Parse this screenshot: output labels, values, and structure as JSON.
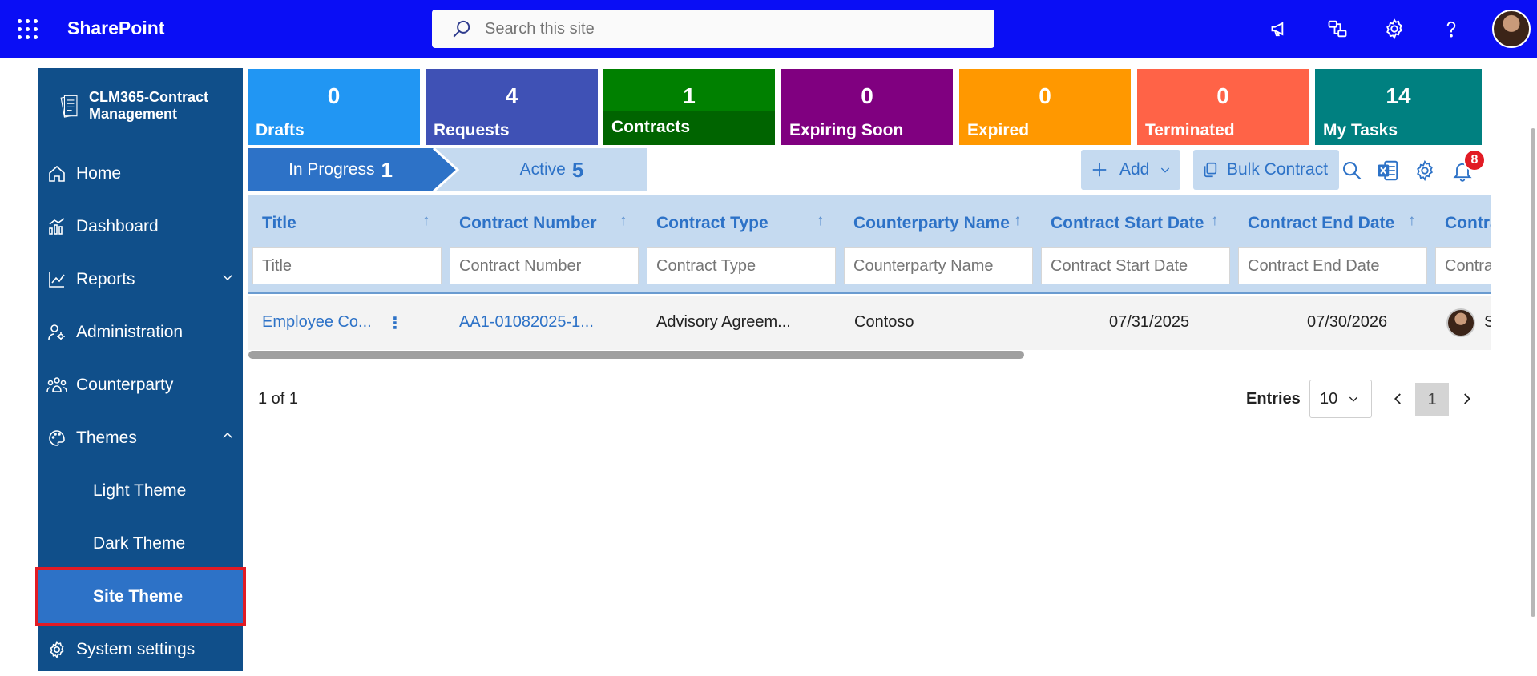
{
  "app": {
    "brand": "SharePoint",
    "search_placeholder": "Search this site",
    "logo_text": "CLM365-Contract Management"
  },
  "sidebar": {
    "items": [
      {
        "label": "Home",
        "icon": "home-icon"
      },
      {
        "label": "Dashboard",
        "icon": "dashboard-icon"
      },
      {
        "label": "Reports",
        "icon": "reports-icon"
      },
      {
        "label": "Administration",
        "icon": "administration-icon"
      },
      {
        "label": "Counterparty",
        "icon": "counterparty-icon"
      },
      {
        "label": "Themes",
        "icon": "palette-icon"
      },
      {
        "label": "Light Theme"
      },
      {
        "label": "Dark Theme"
      },
      {
        "label": "Site Theme"
      },
      {
        "label": "System settings",
        "icon": "gear-icon"
      }
    ]
  },
  "tiles": [
    {
      "count": "0",
      "label": "Drafts",
      "color": "#2196f3"
    },
    {
      "count": "4",
      "label": "Requests",
      "color": "#3f51b5"
    },
    {
      "count": "1",
      "label": "Contracts",
      "color": "#008000"
    },
    {
      "count": "0",
      "label": "Expiring Soon",
      "color": "#800080"
    },
    {
      "count": "0",
      "label": "Expired",
      "color": "#ff9800"
    },
    {
      "count": "0",
      "label": "Terminated",
      "color": "#ff6347"
    },
    {
      "count": "14",
      "label": "My Tasks",
      "color": "#008080"
    }
  ],
  "stages": {
    "in_progress_label": "In Progress",
    "in_progress_count": "1",
    "active_label": "Active",
    "active_count": "5"
  },
  "toolbar": {
    "add_label": "Add",
    "bulk_label": "Bulk Contract",
    "notification_count": "8"
  },
  "table": {
    "columns": [
      {
        "header": "Title",
        "filter": "Title"
      },
      {
        "header": "Contract Number",
        "filter": "Contract Number"
      },
      {
        "header": "Contract Type",
        "filter": "Contract Type"
      },
      {
        "header": "Counterparty Name",
        "filter": "Counterparty Name"
      },
      {
        "header": "Contract Start Date",
        "filter": "Contract Start Date"
      },
      {
        "header": "Contract End Date",
        "filter": "Contract End Date"
      },
      {
        "header": "Contra",
        "filter": "Contra"
      }
    ],
    "rows": [
      {
        "title": "Employee Co...",
        "contract_number": "AA1-01082025-1...",
        "contract_type": "Advisory Agreem...",
        "counterparty": "Contoso",
        "start_date": "07/31/2025",
        "end_date": "07/30/2026",
        "owner_initial": "S"
      }
    ]
  },
  "pagination": {
    "summary": "1 of 1",
    "entries_label": "Entries",
    "entries_value": "10",
    "current_page": "1"
  }
}
